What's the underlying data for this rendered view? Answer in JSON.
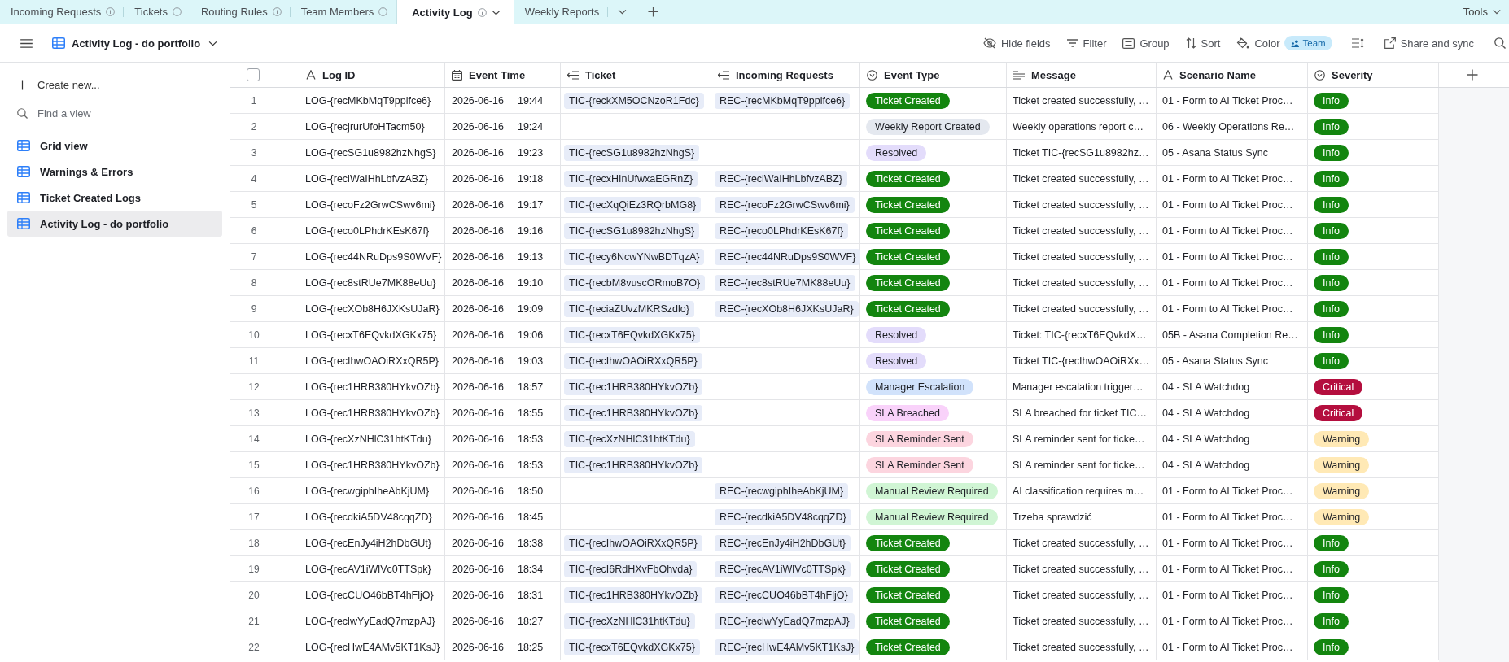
{
  "tabs": [
    {
      "label": "Incoming Requests",
      "info": true,
      "selected": false
    },
    {
      "label": "Tickets",
      "info": true,
      "selected": false
    },
    {
      "label": "Routing Rules",
      "info": true,
      "selected": false
    },
    {
      "label": "Team Members",
      "info": true,
      "selected": false
    },
    {
      "label": "Activity Log",
      "info": true,
      "selected": true
    },
    {
      "label": "Weekly Reports",
      "info": false,
      "selected": false
    }
  ],
  "tab_bar": {
    "tools_label": "Tools"
  },
  "toolbar": {
    "view_name": "Activity Log - do portfolio",
    "actions": [
      {
        "label": "Hide fields",
        "kind": "hide"
      },
      {
        "label": "Filter",
        "kind": "filter"
      },
      {
        "label": "Group",
        "kind": "group"
      },
      {
        "label": "Sort",
        "kind": "sort"
      },
      {
        "label": "Color",
        "kind": "color"
      }
    ],
    "color_field": "Team",
    "share_label": "Share and sync"
  },
  "sidebar": {
    "create_label": "Create new...",
    "search": {
      "placeholder": "Find a view"
    },
    "views": [
      {
        "label": "Grid view",
        "selected": false
      },
      {
        "label": "Warnings & Errors",
        "selected": false
      },
      {
        "label": "Ticket Created Logs",
        "selected": false
      },
      {
        "label": "Activity Log - do portfolio",
        "selected": true
      }
    ]
  },
  "table": {
    "select_all": {
      "checked": false
    },
    "columns": [
      {
        "label": "Log ID",
        "kind": "text"
      },
      {
        "label": "Event Time",
        "kind": "date"
      },
      {
        "label": "Ticket",
        "kind": "link"
      },
      {
        "label": "Incoming Requests",
        "kind": "link"
      },
      {
        "label": "Event Type",
        "kind": "select"
      },
      {
        "label": "Message",
        "kind": "long_text"
      },
      {
        "label": "Scenario Name",
        "kind": "text"
      },
      {
        "label": "Severity",
        "kind": "select"
      }
    ],
    "rows": [
      {
        "number": "1",
        "cells": [
          "LOG-{recMKbMqT9ppifce6}",
          {
            "date": "2026-06-16",
            "time": "19:44"
          },
          "TIC-{reckXM5OCNzoR1Fdc}",
          "REC-{recMKbMqT9ppifce6}",
          {
            "label": "Ticket Created",
            "color": "#13850f"
          },
          "Ticket created successfully, …",
          "01 - Form to AI Ticket Proc…",
          {
            "label": "Info",
            "color": "#13850f"
          }
        ]
      },
      {
        "number": "2",
        "cells": [
          "LOG-{recjrurUfoHTacm50}",
          {
            "date": "2026-06-16",
            "time": "19:24"
          },
          null,
          null,
          {
            "label": "Weekly Report Created",
            "color": "#e4e8ef"
          },
          "Weekly operations report c…",
          "06 - Weekly Operations Re…",
          {
            "label": "Info",
            "color": "#13850f"
          }
        ]
      },
      {
        "number": "3",
        "cells": [
          "LOG-{recSG1u8982hzNhgS}",
          {
            "date": "2026-06-16",
            "time": "19:23"
          },
          "TIC-{recSG1u8982hzNhgS}",
          null,
          {
            "label": "Resolved",
            "color": "#e3dcfb"
          },
          "Ticket TIC-{recSG1u8982hz…",
          "05 - Asana Status Sync",
          {
            "label": "Info",
            "color": "#13850f"
          }
        ]
      },
      {
        "number": "4",
        "cells": [
          "LOG-{reciWaIHhLbfvzABZ}",
          {
            "date": "2026-06-16",
            "time": "19:18"
          },
          "TIC-{recxHInUfwxaEGRnZ}",
          "REC-{reciWaIHhLbfvzABZ}",
          {
            "label": "Ticket Created",
            "color": "#13850f"
          },
          "Ticket created successfully, …",
          "01 - Form to AI Ticket Proc…",
          {
            "label": "Info",
            "color": "#13850f"
          }
        ]
      },
      {
        "number": "5",
        "cells": [
          "LOG-{recoFz2GrwCSwv6mi}",
          {
            "date": "2026-06-16",
            "time": "19:17"
          },
          "TIC-{recXqQiEz3RQrbMG8}",
          "REC-{recoFz2GrwCSwv6mi}",
          {
            "label": "Ticket Created",
            "color": "#13850f"
          },
          "Ticket created successfully, …",
          "01 - Form to AI Ticket Proc…",
          {
            "label": "Info",
            "color": "#13850f"
          }
        ]
      },
      {
        "number": "6",
        "cells": [
          "LOG-{reco0LPhdrKEsK67f}",
          {
            "date": "2026-06-16",
            "time": "19:16"
          },
          "TIC-{recSG1u8982hzNhgS}",
          "REC-{reco0LPhdrKEsK67f}",
          {
            "label": "Ticket Created",
            "color": "#13850f"
          },
          "Ticket created successfully, …",
          "01 - Form to AI Ticket Proc…",
          {
            "label": "Info",
            "color": "#13850f"
          }
        ]
      },
      {
        "number": "7",
        "cells": [
          "LOG-{rec44NRuDps9S0WVF}",
          {
            "date": "2026-06-16",
            "time": "19:13"
          },
          "TIC-{recy6NcwYNwBDTqzA}",
          "REC-{rec44NRuDps9S0WVF}",
          {
            "label": "Ticket Created",
            "color": "#13850f"
          },
          "Ticket created successfully, …",
          "01 - Form to AI Ticket Proc…",
          {
            "label": "Info",
            "color": "#13850f"
          }
        ]
      },
      {
        "number": "8",
        "cells": [
          "LOG-{rec8stRUe7MK88eUu}",
          {
            "date": "2026-06-16",
            "time": "19:10"
          },
          "TIC-{recbM8vuscORmoB7O}",
          "REC-{rec8stRUe7MK88eUu}",
          {
            "label": "Ticket Created",
            "color": "#13850f"
          },
          "Ticket created successfully, …",
          "01 - Form to AI Ticket Proc…",
          {
            "label": "Info",
            "color": "#13850f"
          }
        ]
      },
      {
        "number": "9",
        "cells": [
          "LOG-{recXOb8H6JXKsUJaR}",
          {
            "date": "2026-06-16",
            "time": "19:09"
          },
          "TIC-{reciaZUvzMKRSzdlo}",
          "REC-{recXOb8H6JXKsUJaR}",
          {
            "label": "Ticket Created",
            "color": "#13850f"
          },
          "Ticket created successfully, …",
          "01 - Form to AI Ticket Proc…",
          {
            "label": "Info",
            "color": "#13850f"
          }
        ]
      },
      {
        "number": "10",
        "cells": [
          "LOG-{recxT6EQvkdXGKx75}",
          {
            "date": "2026-06-16",
            "time": "19:06"
          },
          "TIC-{recxT6EQvkdXGKx75}",
          null,
          {
            "label": "Resolved",
            "color": "#e3dcfb"
          },
          "Ticket: TIC-{recxT6EQvkdX…",
          "05B - Asana Completion Re…",
          {
            "label": "Info",
            "color": "#13850f"
          }
        ]
      },
      {
        "number": "11",
        "cells": [
          "LOG-{recIhwOAOiRXxQR5P}",
          {
            "date": "2026-06-16",
            "time": "19:03"
          },
          "TIC-{recIhwOAOiRXxQR5P}",
          null,
          {
            "label": "Resolved",
            "color": "#e3dcfb"
          },
          "Ticket TIC-{recIhwOAOiRXx…",
          "05 - Asana Status Sync",
          {
            "label": "Info",
            "color": "#13850f"
          }
        ]
      },
      {
        "number": "12",
        "cells": [
          "LOG-{rec1HRB380HYkvOZb}",
          {
            "date": "2026-06-16",
            "time": "18:57"
          },
          "TIC-{rec1HRB380HYkvOZb}",
          null,
          {
            "label": "Manager Escalation",
            "color": "#d1e2fb"
          },
          "Manager escalation trigger…",
          "04 - SLA Watchdog",
          {
            "label": "Critical",
            "color": "#b40e3e"
          }
        ]
      },
      {
        "number": "13",
        "cells": [
          "LOG-{rec1HRB380HYkvOZb}",
          {
            "date": "2026-06-16",
            "time": "18:55"
          },
          "TIC-{rec1HRB380HYkvOZb}",
          null,
          {
            "label": "SLA Breached",
            "color": "#f9d2fa"
          },
          "SLA breached for ticket TIC…",
          "04 - SLA Watchdog",
          {
            "label": "Critical",
            "color": "#b40e3e"
          }
        ]
      },
      {
        "number": "14",
        "cells": [
          "LOG-{recXzNHlC31htKTdu}",
          {
            "date": "2026-06-16",
            "time": "18:53"
          },
          "TIC-{recXzNHlC31htKTdu}",
          null,
          {
            "label": "SLA Reminder Sent",
            "color": "#fcd5df"
          },
          "SLA reminder sent for ticke…",
          "04 - SLA Watchdog",
          {
            "label": "Warning",
            "color": "#ffe9b5"
          }
        ]
      },
      {
        "number": "15",
        "cells": [
          "LOG-{rec1HRB380HYkvOZb}",
          {
            "date": "2026-06-16",
            "time": "18:53"
          },
          "TIC-{rec1HRB380HYkvOZb}",
          null,
          {
            "label": "SLA Reminder Sent",
            "color": "#fcd5df"
          },
          "SLA reminder sent for ticke…",
          "04 - SLA Watchdog",
          {
            "label": "Warning",
            "color": "#ffe9b5"
          }
        ]
      },
      {
        "number": "16",
        "cells": [
          "LOG-{recwgiphIheAbKjUM}",
          {
            "date": "2026-06-16",
            "time": "18:50"
          },
          null,
          "REC-{recwgiphIheAbKjUM}",
          {
            "label": "Manual Review Required",
            "color": "#d0f5d4"
          },
          "AI classification requires m…",
          "01 - Form to AI Ticket Proc…",
          {
            "label": "Warning",
            "color": "#ffe9b5"
          }
        ]
      },
      {
        "number": "17",
        "cells": [
          "LOG-{recdkiA5DV48cqqZD}",
          {
            "date": "2026-06-16",
            "time": "18:45"
          },
          null,
          "REC-{recdkiA5DV48cqqZD}",
          {
            "label": "Manual Review Required",
            "color": "#d0f5d4"
          },
          "Trzeba sprawdzić",
          "01 - Form to AI Ticket Proc…",
          {
            "label": "Warning",
            "color": "#ffe9b5"
          }
        ]
      },
      {
        "number": "18",
        "cells": [
          "LOG-{recEnJy4iH2hDbGUt}",
          {
            "date": "2026-06-16",
            "time": "18:38"
          },
          "TIC-{recIhwOAOiRXxQR5P}",
          "REC-{recEnJy4iH2hDbGUt}",
          {
            "label": "Ticket Created",
            "color": "#13850f"
          },
          "Ticket created successfully, …",
          "01 - Form to AI Ticket Proc…",
          {
            "label": "Info",
            "color": "#13850f"
          }
        ]
      },
      {
        "number": "19",
        "cells": [
          "LOG-{recAV1iWlVc0TTSpk}",
          {
            "date": "2026-06-16",
            "time": "18:34"
          },
          "TIC-{recI6RdHXvFbOhvda}",
          "REC-{recAV1iWlVc0TTSpk}",
          {
            "label": "Ticket Created",
            "color": "#13850f"
          },
          "Ticket created successfully, …",
          "01 - Form to AI Ticket Proc…",
          {
            "label": "Info",
            "color": "#13850f"
          }
        ]
      },
      {
        "number": "20",
        "cells": [
          "LOG-{recCUO46bBT4hFljO}",
          {
            "date": "2026-06-16",
            "time": "18:31"
          },
          "TIC-{rec1HRB380HYkvOZb}",
          "REC-{recCUO46bBT4hFljO}",
          {
            "label": "Ticket Created",
            "color": "#13850f"
          },
          "Ticket created successfully, …",
          "01 - Form to AI Ticket Proc…",
          {
            "label": "Info",
            "color": "#13850f"
          }
        ]
      },
      {
        "number": "21",
        "cells": [
          "LOG-{reclwYyEadQ7mzpAJ}",
          {
            "date": "2026-06-16",
            "time": "18:27"
          },
          "TIC-{recXzNHlC31htKTdu}",
          "REC-{reclwYyEadQ7mzpAJ}",
          {
            "label": "Ticket Created",
            "color": "#13850f"
          },
          "Ticket created successfully, …",
          "01 - Form to AI Ticket Proc…",
          {
            "label": "Info",
            "color": "#13850f"
          }
        ]
      },
      {
        "number": "22",
        "cells": [
          "LOG-{recHwE4AMv5KT1KsJ}",
          {
            "date": "2026-06-16",
            "time": "18:25"
          },
          "TIC-{recxT6EQvkdXGKx75}",
          "REC-{recHwE4AMv5KT1KsJ}",
          {
            "label": "Ticket Created",
            "color": "#13850f"
          },
          "Ticket created successfully, …",
          "01 - Form to AI Ticket Proc…",
          {
            "label": "Info",
            "color": "#13850f"
          }
        ]
      }
    ]
  }
}
